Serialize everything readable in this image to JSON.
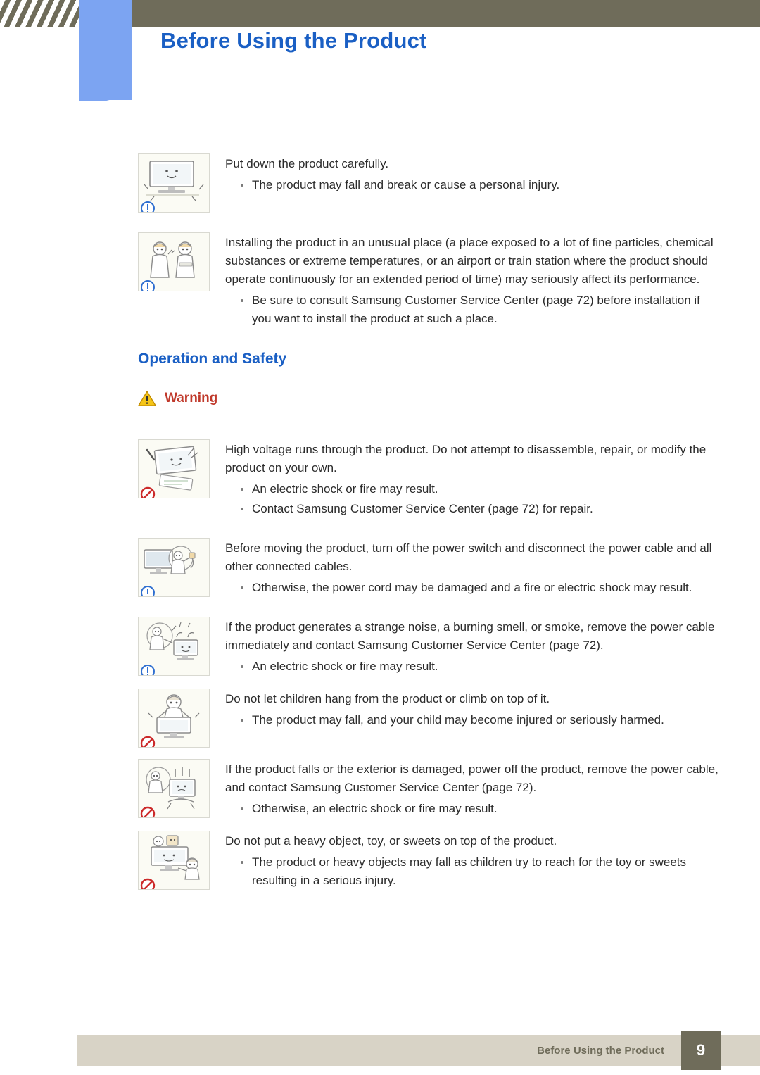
{
  "header": {
    "title": "Before Using the Product"
  },
  "footer": {
    "text": "Before Using the Product",
    "page": "9"
  },
  "sections": [
    {
      "id": "put-down-carefully",
      "figure": "monitor-put-down-icon",
      "badge": "caution-blue-icon",
      "paragraph": "Put down the product carefully.",
      "bullets": [
        "The product may fall and break or cause a personal injury."
      ]
    },
    {
      "id": "unusual-place",
      "figure": "workers-unusual-place-icon",
      "badge": "caution-blue-icon",
      "paragraph": "Installing the product in an unusual place (a place exposed to a lot of fine particles, chemical substances or extreme temperatures, or an airport or train station where the product should operate continuously for an extended period of time) may seriously affect its performance.",
      "bullets": [
        "Be sure to consult Samsung Customer Service Center (page 72) before installation if you want to install the product at such a place."
      ]
    }
  ],
  "operation_and_safety": {
    "title": "Operation and Safety",
    "warning_label": "Warning",
    "warning_icon": "warning-triangle-icon",
    "items": [
      {
        "id": "high-voltage",
        "figure": "disassemble-prohibited-icon",
        "badge": "prohibited-red-icon",
        "paragraph": "High voltage runs through the product. Do not attempt to disassemble, repair, or modify the product on your own.",
        "bullets": [
          "An electric shock or fire may result.",
          "Contact Samsung Customer Service Center (page 72) for repair."
        ]
      },
      {
        "id": "before-moving",
        "figure": "unplug-before-moving-icon",
        "badge": "caution-blue-icon",
        "paragraph": "Before moving the product, turn off the power switch and disconnect the power cable and all other connected cables.",
        "bullets": [
          "Otherwise, the power cord may be damaged and a fire or electric shock may result."
        ]
      },
      {
        "id": "strange-noise",
        "figure": "strange-noise-smoke-icon",
        "badge": "caution-blue-icon",
        "paragraph": "If the product generates a strange noise, a burning smell, or smoke, remove the power cable immediately and contact Samsung Customer Service Center (page 72).",
        "bullets": [
          "An electric shock or fire may result."
        ]
      },
      {
        "id": "children-hang",
        "figure": "child-hanging-prohibited-icon",
        "badge": "prohibited-red-icon",
        "paragraph": "Do not let children hang from the product or climb on top of it.",
        "bullets": [
          "The product may fall, and your child may become injured or seriously harmed."
        ]
      },
      {
        "id": "product-falls",
        "figure": "product-falls-damaged-icon",
        "badge": "prohibited-red-icon",
        "paragraph": "If the product falls or the exterior is damaged, power off the product, remove the power cable, and contact Samsung Customer Service Center (page 72).",
        "bullets": [
          "Otherwise, an electric shock or fire may result."
        ]
      },
      {
        "id": "heavy-object",
        "figure": "heavy-object-on-top-icon",
        "badge": "prohibited-red-icon",
        "paragraph": "Do not put a heavy object, toy, or sweets on top of the product.",
        "bullets": [
          "The product or heavy objects may fall as children try to reach for the toy or sweets resulting in a serious injury."
        ]
      }
    ]
  },
  "colors": {
    "header_band": "#6f6c5a",
    "accent_blue": "#1a5fc4",
    "blue_block": "#7ca4f2",
    "warning_red": "#c0392b",
    "footer_band": "#d8d3c6"
  }
}
